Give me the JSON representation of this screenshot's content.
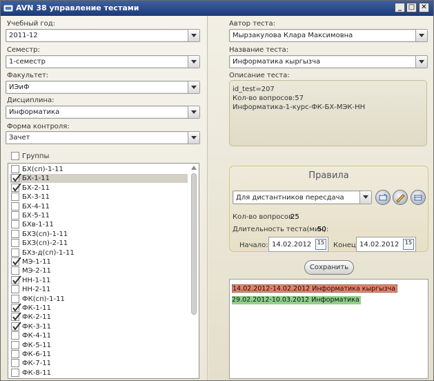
{
  "window": {
    "title": "AVN 38 управление тестами",
    "controls": [
      "_",
      "□",
      "✕"
    ]
  },
  "left": {
    "year": {
      "label": "Учебный год:",
      "value": "2011-12"
    },
    "semester": {
      "label": "Семестр:",
      "value": "1-семестр"
    },
    "faculty": {
      "label": "Факультет:",
      "value": "ИЭиФ"
    },
    "discipline": {
      "label": "Дисциплина:",
      "value": "Информатика"
    },
    "control": {
      "label": "Форма контроля:",
      "value": "Зачет"
    },
    "groups_label": "Группы",
    "groups": [
      {
        "name": "БХ(сп)-1-11",
        "checked": false
      },
      {
        "name": "БХ-1-11",
        "checked": true,
        "selected": true
      },
      {
        "name": "БХ-2-11",
        "checked": true
      },
      {
        "name": "БХ-3-11",
        "checked": false
      },
      {
        "name": "БХ-4-11",
        "checked": false
      },
      {
        "name": "БХ-5-11",
        "checked": false
      },
      {
        "name": "БХв-1-11",
        "checked": false
      },
      {
        "name": "БХЗ(сп)-1-11",
        "checked": false
      },
      {
        "name": "БХЗ(сп)-2-11",
        "checked": false
      },
      {
        "name": "БХз-д(сп)-1-11",
        "checked": false
      },
      {
        "name": "МЭ-1-11",
        "checked": true
      },
      {
        "name": "МЭ-2-11",
        "checked": false
      },
      {
        "name": "НН-1-11",
        "checked": true
      },
      {
        "name": "НН-2-11",
        "checked": false
      },
      {
        "name": "ФК(сп)-1-11",
        "checked": false
      },
      {
        "name": "ФК-1-11",
        "checked": true
      },
      {
        "name": "ФК-2-11",
        "checked": true
      },
      {
        "name": "ФК-3-11",
        "checked": true
      },
      {
        "name": "ФК-4-11",
        "checked": false
      },
      {
        "name": "ФК-5-11",
        "checked": false
      },
      {
        "name": "ФК-6-11",
        "checked": false
      },
      {
        "name": "ФК-7-11",
        "checked": false
      },
      {
        "name": "ФК-8-11",
        "checked": false
      }
    ]
  },
  "right": {
    "author": {
      "label": "Автор теста:",
      "value": "Мырзакулова Клара Максимовна"
    },
    "test_name": {
      "label": "Название теста:",
      "value": "Информатика кыргызча"
    },
    "description": {
      "label": "Описание теста:",
      "lines": [
        "id_test=207",
        "Кол-во вопросов:57",
        "Информатика-1-курс-ФК-БХ-МЭК-НН"
      ]
    },
    "rules": {
      "title": "Правила",
      "mode": "Для дистантников пересдача",
      "questions_label": "Кол-во вопросов:",
      "questions_value": "25",
      "duration_label": "Длительность теста(мин):",
      "duration_value": "50",
      "start_label": "Начало:",
      "start_value": "14.02.2012",
      "end_label": "Конец:",
      "end_value": "14.02.2012",
      "calendar_day": "15"
    },
    "save_label": "Сохранить",
    "results": [
      {
        "text": "14.02.2012-14.02.2012  Информатика кыргызча",
        "color": "#e8826a",
        "selected": true
      },
      {
        "text": "29.02.2012-10.03.2012  Информатика",
        "color": "#8fd08a",
        "selected": false
      }
    ]
  }
}
